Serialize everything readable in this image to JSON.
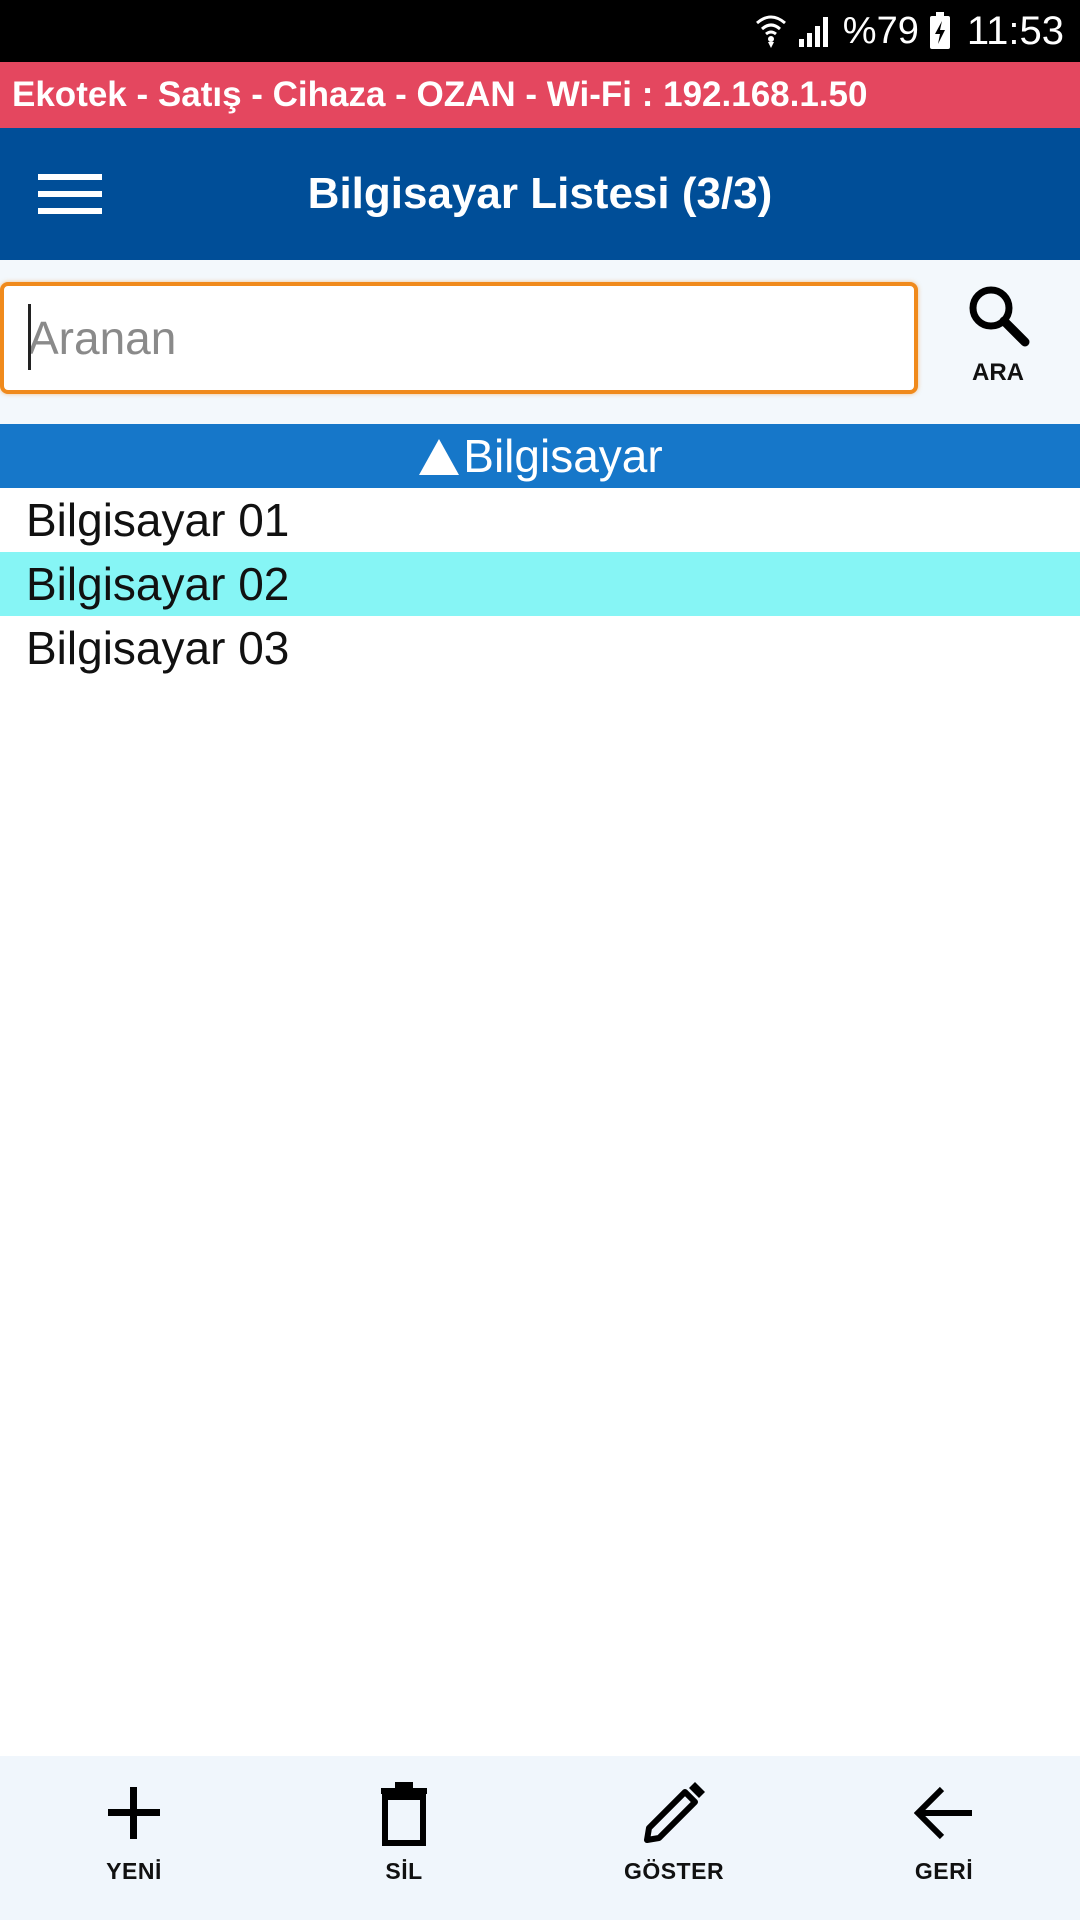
{
  "status_bar": {
    "wifi_icon": "wifi-icon",
    "signal_icon": "signal-icon",
    "battery_percent": "%79",
    "battery_icon": "battery-charging-icon",
    "time": "11:53"
  },
  "info_banner": {
    "text": "Ekotek - Satış - Cihaza - OZAN - Wi-Fi : 192.168.1.50",
    "color": "#e4475f"
  },
  "app_bar": {
    "menu_icon": "hamburger-menu-icon",
    "title": "Bilgisayar Listesi (3/3)",
    "color": "#004e98"
  },
  "search": {
    "placeholder": "Aranan",
    "value": "",
    "button_icon": "search-icon",
    "button_label": "ARA",
    "border_color": "#f08a1c"
  },
  "list": {
    "column_header": "Bilgisayar",
    "sort_icon": "sort-ascending-icon",
    "header_color": "#1677c9",
    "selected_color": "#86f5f5",
    "items": [
      {
        "label": "Bilgisayar 01",
        "selected": false
      },
      {
        "label": "Bilgisayar 02",
        "selected": true
      },
      {
        "label": "Bilgisayar 03",
        "selected": false
      }
    ]
  },
  "bottom_bar": {
    "new": {
      "label": "YENİ",
      "icon": "plus-icon"
    },
    "delete": {
      "label": "SİL",
      "icon": "trash-icon"
    },
    "show": {
      "label": "GÖSTER",
      "icon": "pencil-icon"
    },
    "back": {
      "label": "GERİ",
      "icon": "arrow-left-icon"
    }
  }
}
